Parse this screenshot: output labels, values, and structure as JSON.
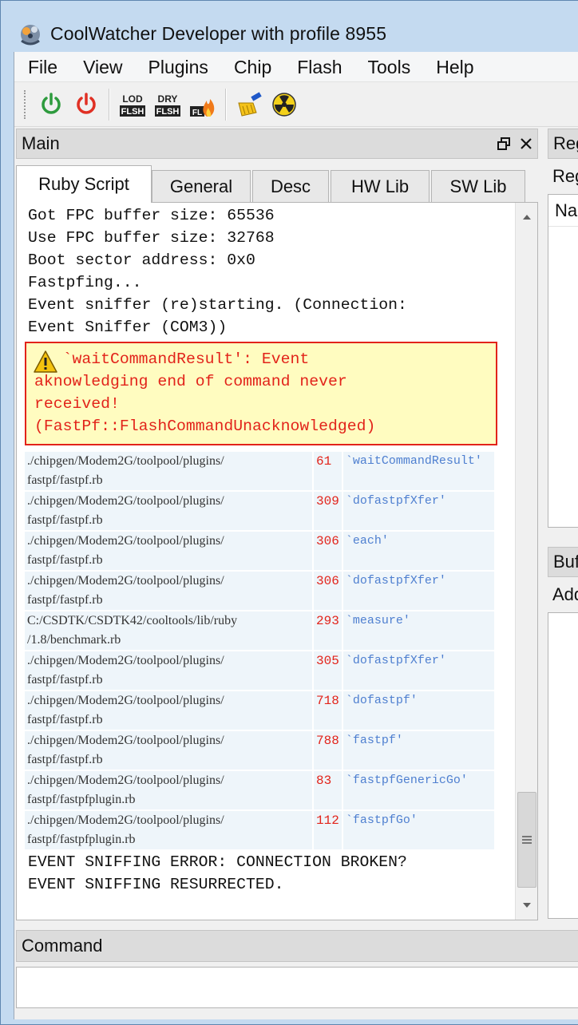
{
  "window": {
    "title": "CoolWatcher Developer with profile 8955"
  },
  "menu": [
    "File",
    "View",
    "Plugins",
    "Chip",
    "Flash",
    "Tools",
    "Help"
  ],
  "toolbar": {
    "icons": [
      "power-on-icon",
      "power-off-icon",
      "lod-flash-icon",
      "dry-flash-icon",
      "fl-flash-icon",
      "clean-brush-icon",
      "radiation-icon"
    ],
    "lod_label": [
      "LOD",
      "FLSH"
    ],
    "dry_label": [
      "DRY",
      "FLSH"
    ],
    "fl_label": "FL",
    "colors": {
      "power_on": "#2e9b3e",
      "power_off": "#e03024"
    }
  },
  "main_dock": {
    "title": "Main",
    "tabs": [
      "Ruby Script",
      "General",
      "Desc",
      "HW Lib",
      "SW Lib"
    ],
    "active_tab": "Ruby Script",
    "console_lines_before": [
      "Got FPC buffer size: 65536",
      "Use FPC buffer size: 32768",
      "Boot sector address: 0x0",
      "Fastpfing...",
      "Event sniffer (re)starting. (Connection:",
      "Event Sniffer (COM3))"
    ],
    "warning": {
      "text": "   `waitCommandResult': Event\naknowledging end of command never\nreceived!\n(FastPf::FlashCommandUnacknowledged)",
      "color": "#e2231a",
      "background": "#fffcc0"
    },
    "backtrace": [
      {
        "path1": "./chipgen/Modem2G/toolpool/plugins/",
        "path2": "fastpf/fastpf.rb",
        "line": "61",
        "method": "`waitCommandResult'"
      },
      {
        "path1": "./chipgen/Modem2G/toolpool/plugins/",
        "path2": "fastpf/fastpf.rb",
        "line": "309",
        "method": "`dofastpfXfer'"
      },
      {
        "path1": "./chipgen/Modem2G/toolpool/plugins/",
        "path2": "fastpf/fastpf.rb",
        "line": "306",
        "method": "`each'"
      },
      {
        "path1": "./chipgen/Modem2G/toolpool/plugins/",
        "path2": "fastpf/fastpf.rb",
        "line": "306",
        "method": "`dofastpfXfer'"
      },
      {
        "path1": "C:/CSDTK/CSDTK42/cooltools/lib/ruby",
        "path2": "/1.8/benchmark.rb",
        "line": "293",
        "method": "`measure'"
      },
      {
        "path1": "./chipgen/Modem2G/toolpool/plugins/",
        "path2": "fastpf/fastpf.rb",
        "line": "305",
        "method": "`dofastpfXfer'"
      },
      {
        "path1": "./chipgen/Modem2G/toolpool/plugins/",
        "path2": "fastpf/fastpf.rb",
        "line": "718",
        "method": "`dofastpf'"
      },
      {
        "path1": "./chipgen/Modem2G/toolpool/plugins/",
        "path2": "fastpf/fastpf.rb",
        "line": "788",
        "method": "`fastpf'"
      },
      {
        "path1": "./chipgen/Modem2G/toolpool/plugins/",
        "path2": "fastpf/fastpfplugin.rb",
        "line": "83",
        "method": "`fastpfGenericGo'"
      },
      {
        "path1": "./chipgen/Modem2G/toolpool/plugins/",
        "path2": "fastpf/fastpfplugin.rb",
        "line": "112",
        "method": "`fastpfGo'"
      }
    ],
    "console_lines_after": [
      "EVENT SNIFFING ERROR: CONNECTION BROKEN?",
      "EVENT SNIFFING RESURRECTED."
    ]
  },
  "right_top_dock": {
    "title": "Reg",
    "label": "Reg",
    "column": "Na"
  },
  "right_bottom_dock": {
    "title": "Buf",
    "label": "Add"
  },
  "command_dock": {
    "title": "Command",
    "input_value": ""
  }
}
